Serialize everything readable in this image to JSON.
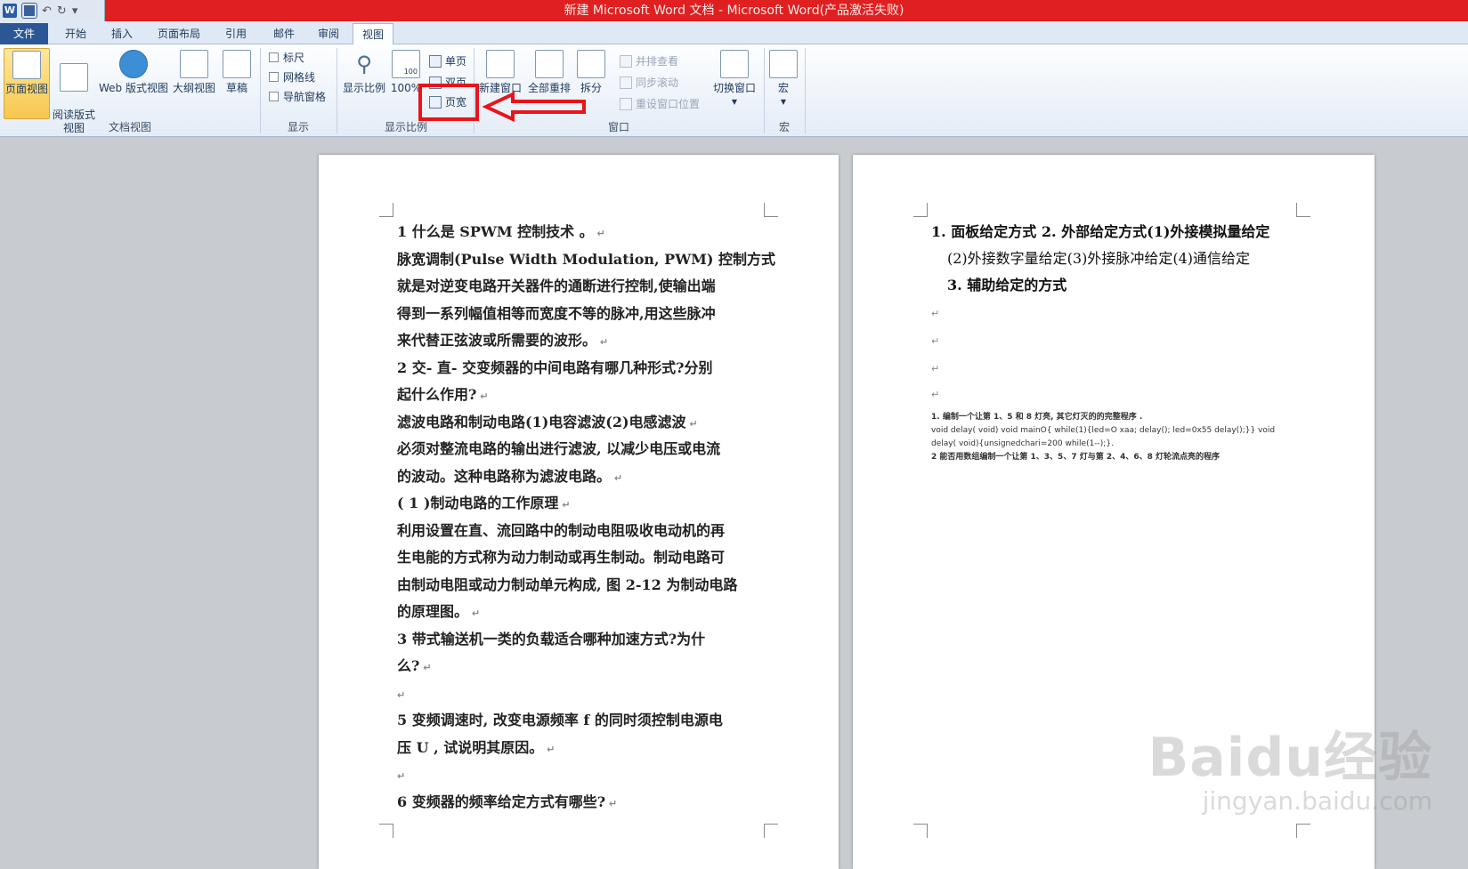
{
  "window": {
    "title": "新建 Microsoft Word 文档 - Microsoft Word(产品激活失败)",
    "qat_icons": [
      "word-app-icon",
      "save-icon",
      "undo-icon",
      "redo-icon",
      "customize-icon"
    ]
  },
  "tabs": [
    {
      "label": "文件"
    },
    {
      "label": "开始"
    },
    {
      "label": "插入"
    },
    {
      "label": "页面布局"
    },
    {
      "label": "引用"
    },
    {
      "label": "邮件"
    },
    {
      "label": "审阅"
    },
    {
      "label": "视图"
    }
  ],
  "ribbon": {
    "doc_view": {
      "group_label": "文档视图",
      "buttons": [
        {
          "label": "页面视图"
        },
        {
          "label": "阅读版式\n视图"
        },
        {
          "label": "Web 版式视图"
        },
        {
          "label": "大纲视图"
        },
        {
          "label": "草稿"
        }
      ]
    },
    "show": {
      "group_label": "显示",
      "items": [
        {
          "label": "标尺"
        },
        {
          "label": "网格线"
        },
        {
          "label": "导航窗格"
        }
      ]
    },
    "zoom": {
      "group_label": "显示比例",
      "zoom_label": "显示比例",
      "hundred_label": "100%",
      "hundred_icon_text": "100",
      "one_page": "单页",
      "two_pages": "双页",
      "page_width": "页宽"
    },
    "window": {
      "group_label": "窗口",
      "new_window": "新建窗口",
      "arrange_all": "全部重排",
      "split": "拆分",
      "side_by_side": "并排查看",
      "sync_scroll": "同步滚动",
      "reset_position": "重设窗口位置",
      "switch_windows": "切换窗口"
    },
    "macros": {
      "group_label": "宏",
      "label": "宏"
    }
  },
  "page1": {
    "paragraphs": [
      "1 什么是 SPWM 控制技术 。",
      "脉宽调制(Pulse Width Modulation, PWM) 控制方式",
      "就是对逆变电路开关器件的通断进行控制,使输出端",
      "得到一系列幅值相等而宽度不等的脉冲,用这些脉冲",
      "来代替正弦波或所需要的波形。",
      "2 交- 直- 交变频器的中间电路有哪几种形式?分别",
      "起什么作用?",
      "滤波电路和制动电路(1)电容滤波(2)电感滤波",
      "必须对整流电路的输出进行滤波, 以减少电压或电流",
      "的波动。这种电路称为滤波电路。",
      "( 1 )制动电路的工作原理",
      "利用设置在直、流回路中的制动电阻吸收电动机的再",
      "生电能的方式称为动力制动或再生制动。制动电路可",
      "由制动电阻或动力制动单元构成, 图 2-12 为制动电路",
      "的原理图。",
      "3 带式输送机一类的负载适合哪种加速方式?为什",
      "么?",
      "",
      "5 变频调速时, 改变电源频率 f 的同时须控制电源电",
      "压 U , 试说明其原因。",
      "",
      "6 变频器的频率给定方式有哪些?"
    ],
    "para_marks": [
      1,
      0,
      0,
      0,
      1,
      0,
      1,
      1,
      0,
      1,
      1,
      0,
      0,
      0,
      1,
      0,
      1,
      1,
      0,
      1,
      1,
      1
    ]
  },
  "page2": {
    "line1": "1. 面板给定方式 2. 外部给定方式(1)外接模拟量给定",
    "line2": "(2)外接数字量给定(3)外接脉冲给定(4)通信给定",
    "line3": "3. 辅助给定的方式",
    "small1": "1.  编制一个让第 1、5 和 8 灯亮, 其它灯灭的的完整程序 .",
    "small2": "void delay( void) void mainO{ while(1){led=O xaa; delay(); led=0x55 delay();}} void",
    "small3": "delay( void){unsignedchari=200 while(1--);}.",
    "small4": "2 能否用数组编制一个让第 1、3、5、7 灯与第 2、4、6、8 灯轮流点亮的程序"
  },
  "watermark": {
    "main": "Baidu经验",
    "sub": "jingyan.baidu.com"
  }
}
